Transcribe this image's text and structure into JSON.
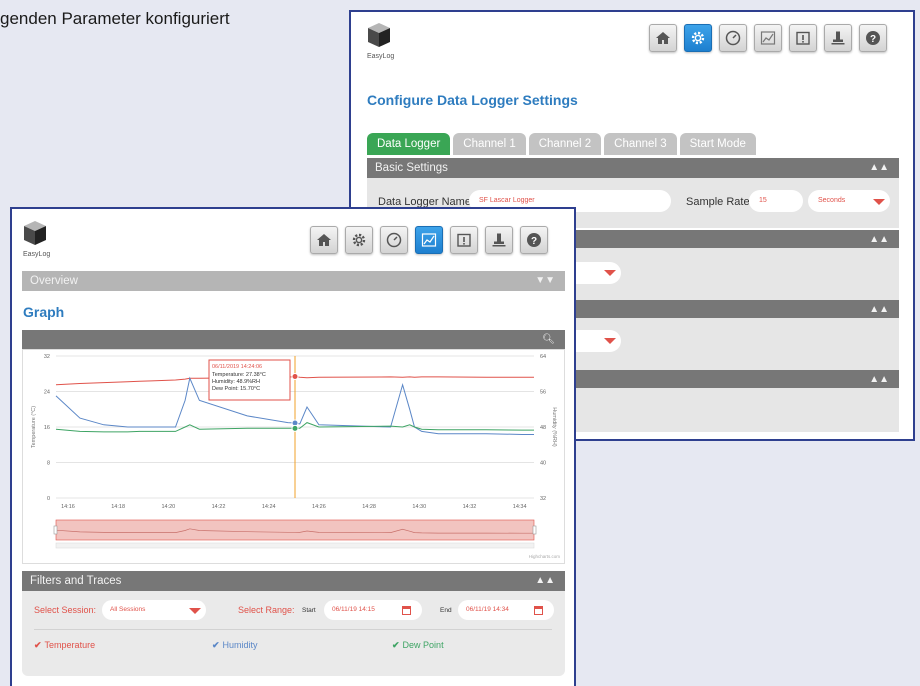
{
  "heading_text": "genden Parameter konfiguriert",
  "logo_text": "EasyLog",
  "toolbar_icons": [
    "home-icon",
    "gear-icon",
    "gauge-icon",
    "graph-icon",
    "alert-icon",
    "usb-logger-icon",
    "help-icon"
  ],
  "settings_window": {
    "active_icon": "gear-icon",
    "title": "Configure Data Logger Settings",
    "tabs": [
      "Data Logger",
      "Channel 1",
      "Channel 2",
      "Channel 3",
      "Start Mode"
    ],
    "active_tab": "Data Logger",
    "basic_settings_label": "Basic Settings",
    "logger_name_label": "Data Logger Name",
    "logger_name_value": "SF Lascar Logger",
    "sample_rate_label": "Sample Rate",
    "sample_rate_value": "15",
    "sample_rate_unit": "Seconds"
  },
  "graph_window": {
    "active_icon": "graph-icon",
    "overview_label": "Overview",
    "title": "Graph",
    "tooltip": {
      "time": "06/11/2019 14:24:06",
      "temperature": "Temperature: 27.38°C",
      "humidity": "Humidity: 48.9%RH",
      "dew_point": "Dew Point: 15.70°C"
    },
    "credit": "Highcharts.com",
    "filters_label": "Filters and Traces",
    "select_session_label": "Select Session:",
    "session_value": "All Sessions",
    "select_range_label": "Select Range:",
    "start_label": "Start",
    "start_value": "06/11/19 14:15",
    "end_label": "End",
    "end_value": "06/11/19 14:34",
    "traces": [
      {
        "label": "Temperature",
        "color": "#e0524a"
      },
      {
        "label": "Humidity",
        "color": "#5b87c7"
      },
      {
        "label": "Dew Point",
        "color": "#3ea464"
      }
    ]
  },
  "chart_data": {
    "type": "line",
    "xlabel": "",
    "ylabel_left": "Temperature (°C)",
    "ylabel_right": "Humidity (%RH)",
    "x_ticks": [
      "14:16",
      "14:18",
      "14:20",
      "14:22",
      "14:24",
      "14:26",
      "14:28",
      "14:30",
      "14:32",
      "14:34"
    ],
    "y_left_ticks": [
      "0",
      "8",
      "16",
      "24",
      "32"
    ],
    "y_right_ticks": [
      "32",
      "40",
      "48",
      "56",
      "64"
    ],
    "y_left_range": [
      0,
      32
    ],
    "y_right_range": [
      32,
      64
    ],
    "x": [
      0,
      1,
      2,
      3,
      3.5,
      4,
      5,
      5.4,
      5.6,
      6,
      8,
      9.7,
      10,
      10.2,
      10.5,
      11,
      14,
      14.5,
      14.8,
      15,
      15.3,
      16,
      18,
      19.5,
      20
    ],
    "series": [
      {
        "name": "Temperature",
        "axis": "left",
        "color": "#e0524a",
        "values": [
          25.5,
          25.8,
          26.0,
          26.2,
          26.3,
          26.4,
          26.6,
          26.8,
          27.0,
          27.0,
          27.1,
          27.2,
          27.38,
          27.2,
          27.1,
          27.2,
          27.3,
          27.2,
          27.3,
          27.2,
          27.3,
          27.3,
          27.2,
          27.2,
          27.2
        ]
      },
      {
        "name": "Humidity",
        "axis": "right",
        "color": "#5b87c7",
        "values": [
          55,
          50,
          48.5,
          48.0,
          48.0,
          48.0,
          48.0,
          54.0,
          59.0,
          54.0,
          50.5,
          49.0,
          48.9,
          48.7,
          52.5,
          48.5,
          48.0,
          57.5,
          52.0,
          48.0,
          47.0,
          46.5,
          46.5,
          46.3,
          46.3
        ]
      },
      {
        "name": "Dew Point",
        "axis": "left",
        "color": "#3ea464",
        "values": [
          15.5,
          15.0,
          14.9,
          14.9,
          15.0,
          15.0,
          15.0,
          16.0,
          16.5,
          15.5,
          15.7,
          15.7,
          15.7,
          15.7,
          17.0,
          16.0,
          16.2,
          16.0,
          16.5,
          16.0,
          15.5,
          15.4,
          15.4,
          15.3,
          15.3
        ]
      }
    ],
    "cursor_x": 10,
    "grid": true,
    "legend": "none"
  }
}
